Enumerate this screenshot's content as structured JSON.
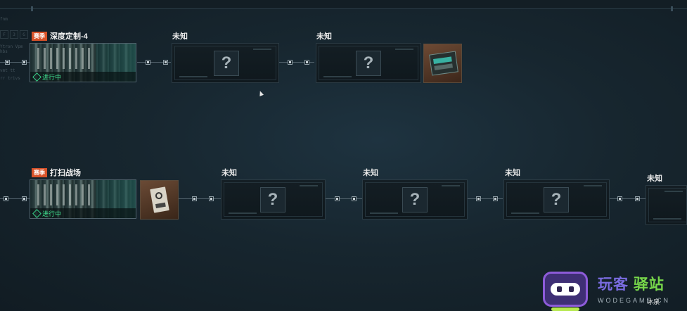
{
  "side_panel": {
    "keys": [
      "F",
      "3",
      "G"
    ],
    "lines": [
      "fnm",
      "Ytron Vpm hbs",
      "vmt tt",
      "rr trivs"
    ]
  },
  "row1": {
    "mission": {
      "badge": "赛季",
      "title": "深度定制-4",
      "status": "进行中"
    },
    "unknown_cards": [
      {
        "title": "未知",
        "mark": "?"
      },
      {
        "title": "未知",
        "mark": "?"
      }
    ],
    "reward": {
      "icon": "tech-case-icon"
    }
  },
  "row2": {
    "mission": {
      "badge": "赛季",
      "title": "打扫战场",
      "status": "进行中"
    },
    "reward": {
      "icon": "paper-card-icon"
    },
    "unknown_cards": [
      {
        "title": "未知",
        "mark": "?"
      },
      {
        "title": "未知",
        "mark": "?"
      },
      {
        "title": "未知",
        "mark": "?"
      },
      {
        "title": "未知",
        "mark": "?"
      }
    ]
  },
  "watermark": {
    "name_part1": "玩客",
    "name_part2": "驿站",
    "domain": "WODEGAME.CN",
    "overlay_text": "冰泉"
  },
  "colors": {
    "season_badge": "#d9532a",
    "in_progress": "#3fe08f",
    "wm_purple": "#7a6ce0",
    "wm_green": "#77d64a"
  }
}
